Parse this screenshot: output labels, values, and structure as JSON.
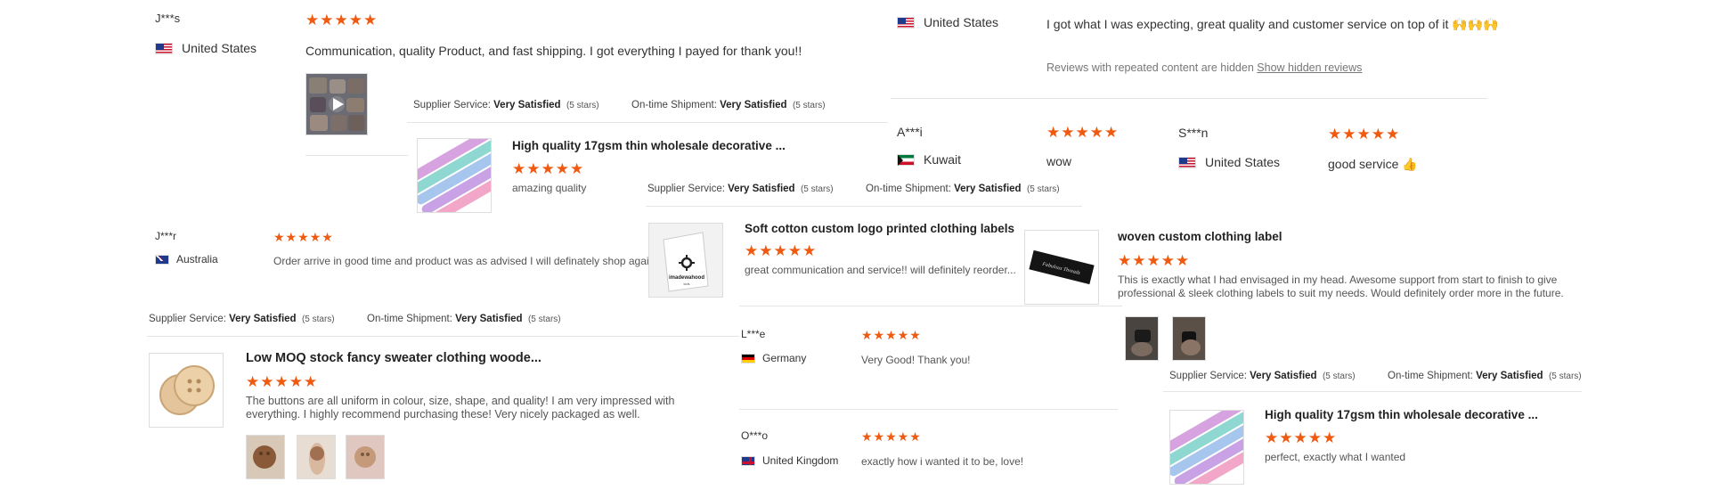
{
  "review_a": {
    "name": "J***s",
    "country": "United States",
    "stars": "★★★★★",
    "text": "Communication, quality Product, and fast shipping. I got everything I payed for thank you!!"
  },
  "review_b": {
    "country": "United States",
    "text": "I got what I was expecting, great quality and customer service on top of it 🙌🙌🙌"
  },
  "hidden": {
    "text": "Reviews with repeated content are hidden",
    "link": "Show hidden reviews"
  },
  "labels": {
    "supplier_service": "Supplier Service:",
    "on_time_shipment": "On-time Shipment:",
    "very_satisfied": "Very Satisfied",
    "five_stars": "(5 stars)"
  },
  "product_1": {
    "title": "High quality 17gsm thin wholesale decorative ...",
    "stars": "★★★★★",
    "review": "amazing quality"
  },
  "review_c": {
    "name": "A***i",
    "country": "Kuwait",
    "stars": "★★★★★",
    "text": "wow"
  },
  "review_d": {
    "name": "S***n",
    "country": "United States",
    "stars": "★★★★★",
    "text": "good service 👍"
  },
  "review_e": {
    "name": "J***r",
    "country": "Australia",
    "stars": "★★★★★",
    "text": "Order arrive in good time and product was as advised I will definately shop again"
  },
  "product_2": {
    "title": "Soft cotton custom logo printed clothing labels",
    "stars": "★★★★★",
    "review": "great communication and service!! will definitely reorder...",
    "label_brand": "imadewahood",
    "label_sub": "kids"
  },
  "product_3": {
    "title": "woven custom clothing label",
    "stars": "★★★★★",
    "review": "This is exactly what I had envisaged in my head. Awesome support from start to finish to give professional & sleek clothing labels to suit my needs. Would definitely order more in the future.",
    "label_text": "Fabulous Threads"
  },
  "product_4": {
    "title": "Low MOQ stock fancy sweater clothing woode...",
    "stars": "★★★★★",
    "review": "The buttons are all uniform in colour, size, shape, and quality! I am very impressed with everything. I highly recommend purchasing these! Very nicely packaged as well."
  },
  "review_f": {
    "name": "L***e",
    "country": "Germany",
    "stars": "★★★★★",
    "text": "Very Good! Thank you!"
  },
  "review_g": {
    "name": "O***o",
    "country": "United Kingdom",
    "stars": "★★★★★",
    "text": "exactly how i wanted it to be, love!"
  },
  "product_5": {
    "title": "High quality 17gsm thin wholesale decorative ...",
    "stars": "★★★★★",
    "review": "perfect, exactly what I wanted"
  }
}
